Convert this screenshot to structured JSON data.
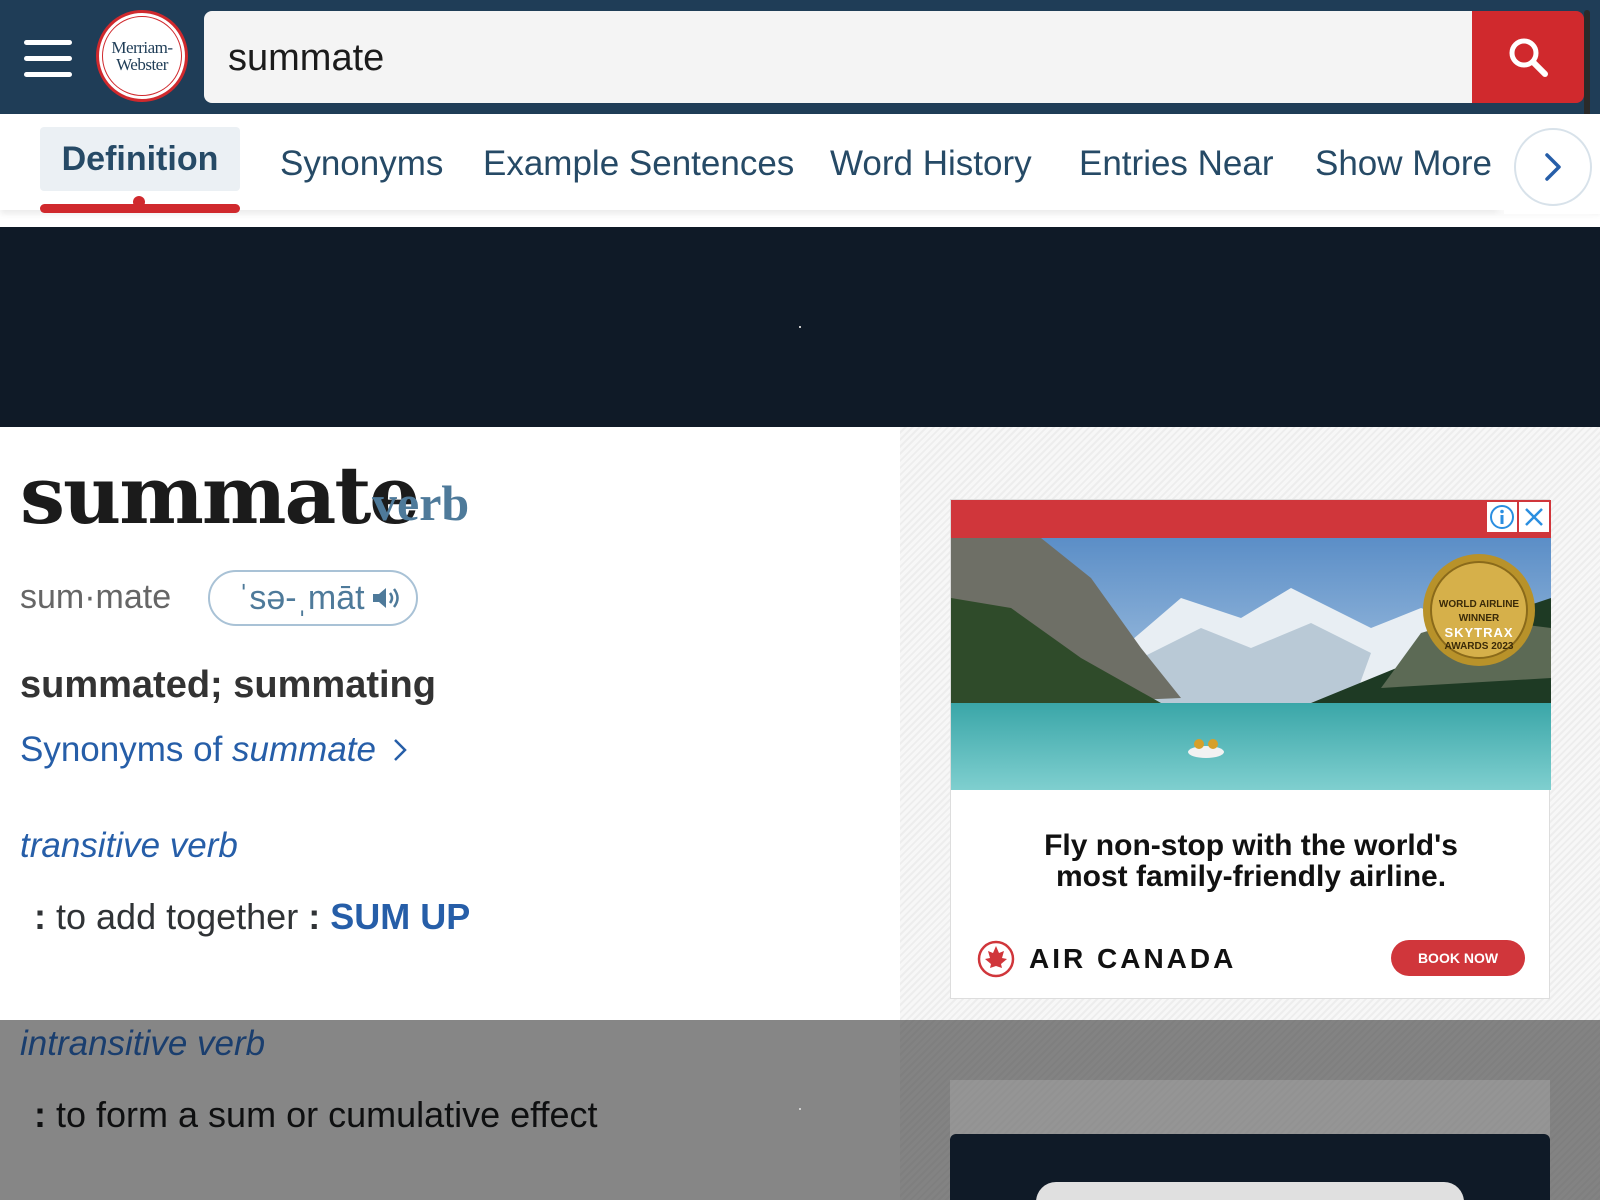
{
  "header": {
    "logo_line1": "Merriam-",
    "logo_line2": "Webster",
    "search_value": "summate"
  },
  "tabs": [
    {
      "label": "Definition",
      "active": true
    },
    {
      "label": "Synonyms"
    },
    {
      "label": "Example Sentences"
    },
    {
      "label": "Word History"
    },
    {
      "label": "Entries Near"
    },
    {
      "label": "Show More"
    }
  ],
  "entry": {
    "headword": "summate",
    "part_of_speech": "verb",
    "syllables": "sum·mate",
    "pronunciation": "ˈsə-ˌmāt",
    "inflections": "summated; summating",
    "synonyms_link_prefix": "Synonyms of",
    "synonyms_link_word": "summate",
    "senses": [
      {
        "verb_divider": "transitive verb",
        "colon": ":",
        "text": " to add together ",
        "colon2": ":",
        "xref": "SUM UP"
      },
      {
        "verb_divider": "intransitive verb",
        "colon": ":",
        "text": " to form a sum or cumulative effect"
      }
    ]
  },
  "ad": {
    "headline_line1": "Fly non-stop with the world's",
    "headline_line2": "most family-friendly airline.",
    "brand": "AIR CANADA",
    "cta": "BOOK NOW",
    "badge_line1": "WORLD AIRLINE",
    "badge_line2": "WINNER",
    "badge_line3": "SKYTRAX",
    "badge_line4": "AWARDS 2023"
  },
  "colors": {
    "header_bg": "#1f3d57",
    "accent_red": "#d0292d",
    "link_blue": "#265ea8",
    "ad_banner_bg": "#0f1a27"
  },
  "icons": [
    "hamburger-menu-icon",
    "search-icon",
    "chevron-right-icon",
    "speaker-icon",
    "info-icon",
    "close-icon",
    "maple-leaf-icon"
  ]
}
